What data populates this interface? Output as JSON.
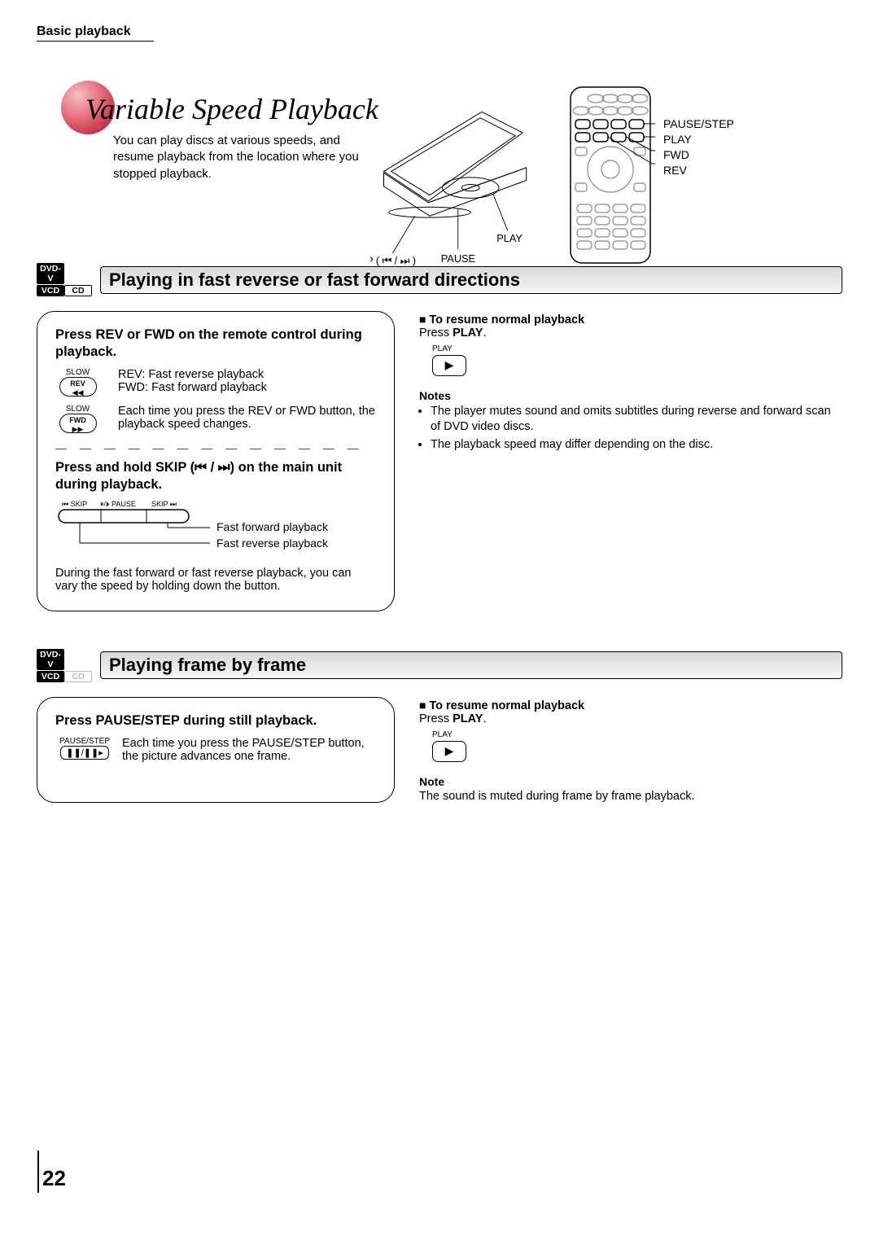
{
  "breadcrumb": "Basic playback",
  "title": "Variable Speed Playback",
  "intro": "You can play discs at various speeds, and resume playback from the location where you stopped playback.",
  "player_labels": {
    "skip": "SKIP ( ⏮ / ⏭ )",
    "play": "PLAY",
    "pause": "PAUSE"
  },
  "remote_labels": {
    "pause_step": "PAUSE/STEP",
    "play": "PLAY",
    "fwd": "FWD",
    "rev": "REV"
  },
  "section1": {
    "badges": {
      "top": "DVD-V",
      "left": "VCD",
      "right": "CD"
    },
    "title": "Playing in fast reverse or fast forward directions",
    "panel": {
      "p1": "Press REV or FWD on the remote control during playback.",
      "k_rev_top": "SLOW",
      "k_rev": "REV",
      "k_fwd_top": "SLOW",
      "k_fwd": "FWD",
      "rev_line1": "REV:  Fast reverse playback",
      "rev_line2": "FWD: Fast forward playback",
      "expl": "Each time you press the REV or FWD button, the playback speed changes.",
      "p2": "Press and hold SKIP (⏮ / ⏭) on the main unit during playback.",
      "strip_l": "⏮ SKIP",
      "strip_m": "⏸/⏵ PAUSE",
      "strip_r": "SKIP ⏭",
      "callout_ffwd": "Fast forward playback",
      "callout_frev": "Fast reverse playback",
      "p3": "During the fast forward or fast reverse playback, you can vary the speed by holding down the button."
    },
    "right": {
      "h": "To resume normal playback",
      "body1": "Press ",
      "body1b": "PLAY",
      "body1c": ".",
      "play_label": "PLAY",
      "notes_h": "Notes",
      "n1": "The player mutes sound and omits subtitles during reverse and forward scan of DVD video discs.",
      "n2": "The playback speed may differ depending on the disc."
    }
  },
  "section2": {
    "badges": {
      "top": "DVD-V",
      "left": "VCD",
      "right": "CD"
    },
    "title": "Playing frame by frame",
    "panel": {
      "p1": "Press PAUSE/STEP during still playback.",
      "key_top": "PAUSE/STEP",
      "key_sym": "❚❚/❚❚▸",
      "expl": "Each time you press the PAUSE/STEP button, the picture advances one frame."
    },
    "right": {
      "h": "To resume normal playback",
      "body1": "Press ",
      "body1b": "PLAY",
      "body1c": ".",
      "play_label": "PLAY",
      "notes_h": "Note",
      "n1": "The sound is muted during frame by frame playback."
    }
  },
  "page_number": "22"
}
